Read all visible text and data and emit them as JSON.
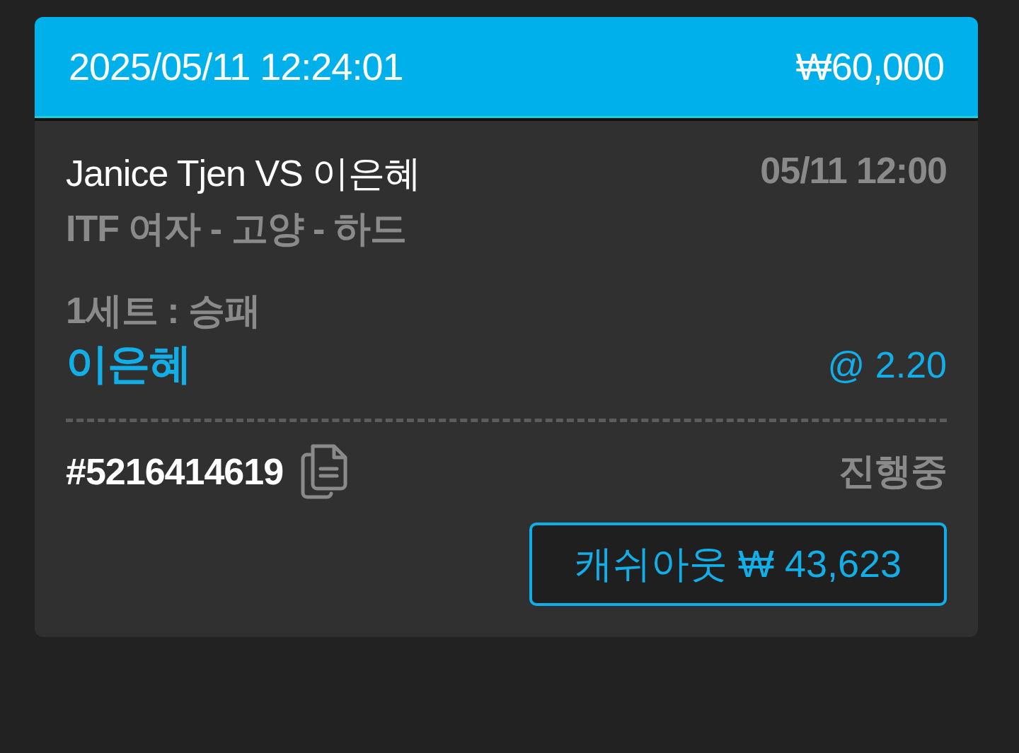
{
  "header": {
    "placed_at": "2025/05/11 12:24:01",
    "stake": "₩60,000"
  },
  "match": {
    "title": "Janice Tjen VS 이은혜",
    "time": "05/11 12:00",
    "league": "ITF 여자 - 고양 - 하드"
  },
  "bet": {
    "market": "1세트 : 승패",
    "pick": "이은혜",
    "odds": "@ 2.20"
  },
  "ticket": {
    "id": "#5216414619",
    "status": "진행중"
  },
  "cashout": {
    "label": "캐쉬아웃 ₩ 43,623"
  }
}
